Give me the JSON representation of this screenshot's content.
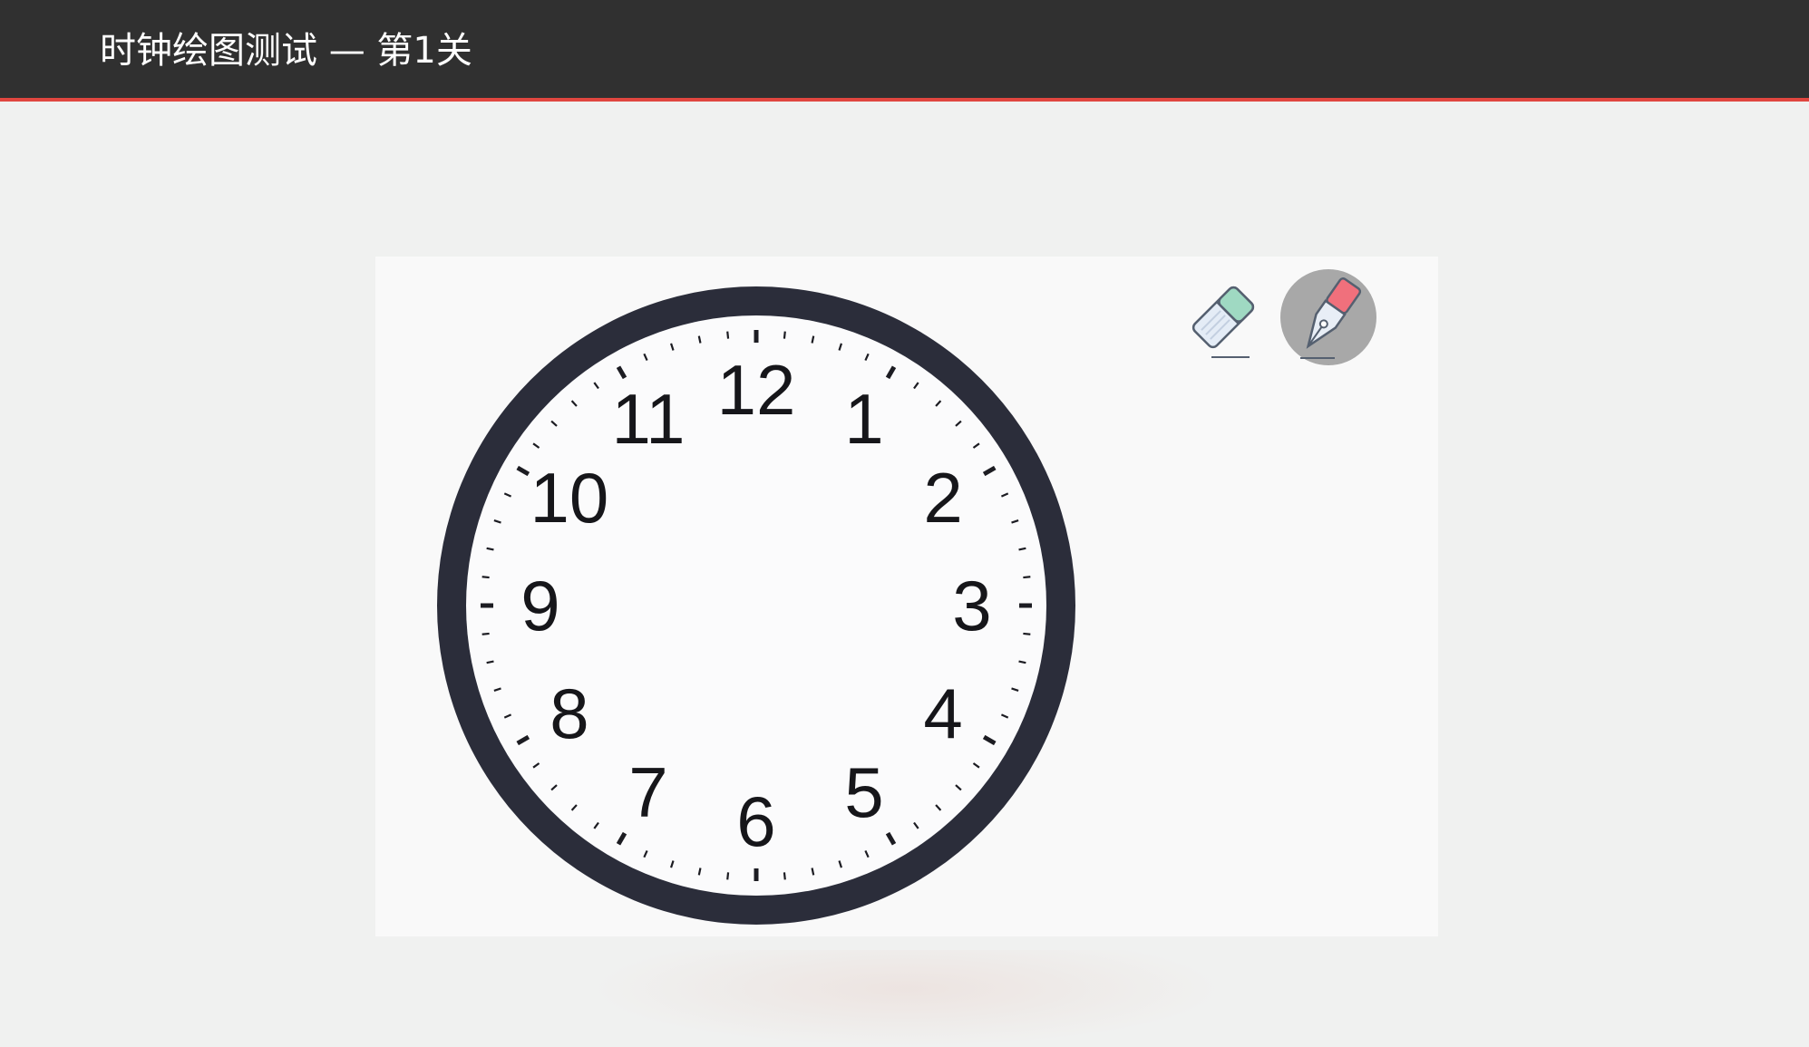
{
  "header": {
    "title": "时钟绘图测试 — 第1关"
  },
  "clock": {
    "numerals": [
      "12",
      "1",
      "2",
      "3",
      "4",
      "5",
      "6",
      "7",
      "8",
      "9",
      "10",
      "11"
    ]
  },
  "tools": {
    "eraser_icon": "eraser-icon",
    "pen_icon": "fountain-pen-icon",
    "selected": "pen"
  },
  "colors": {
    "header_bg": "#303030",
    "header_accent": "#e0463f",
    "clock_rim": "#2b2d3a",
    "eraser_green": "#9fd9c2",
    "pen_pink": "#f0707c",
    "pen_selected_bg": "#a8a8a8"
  }
}
